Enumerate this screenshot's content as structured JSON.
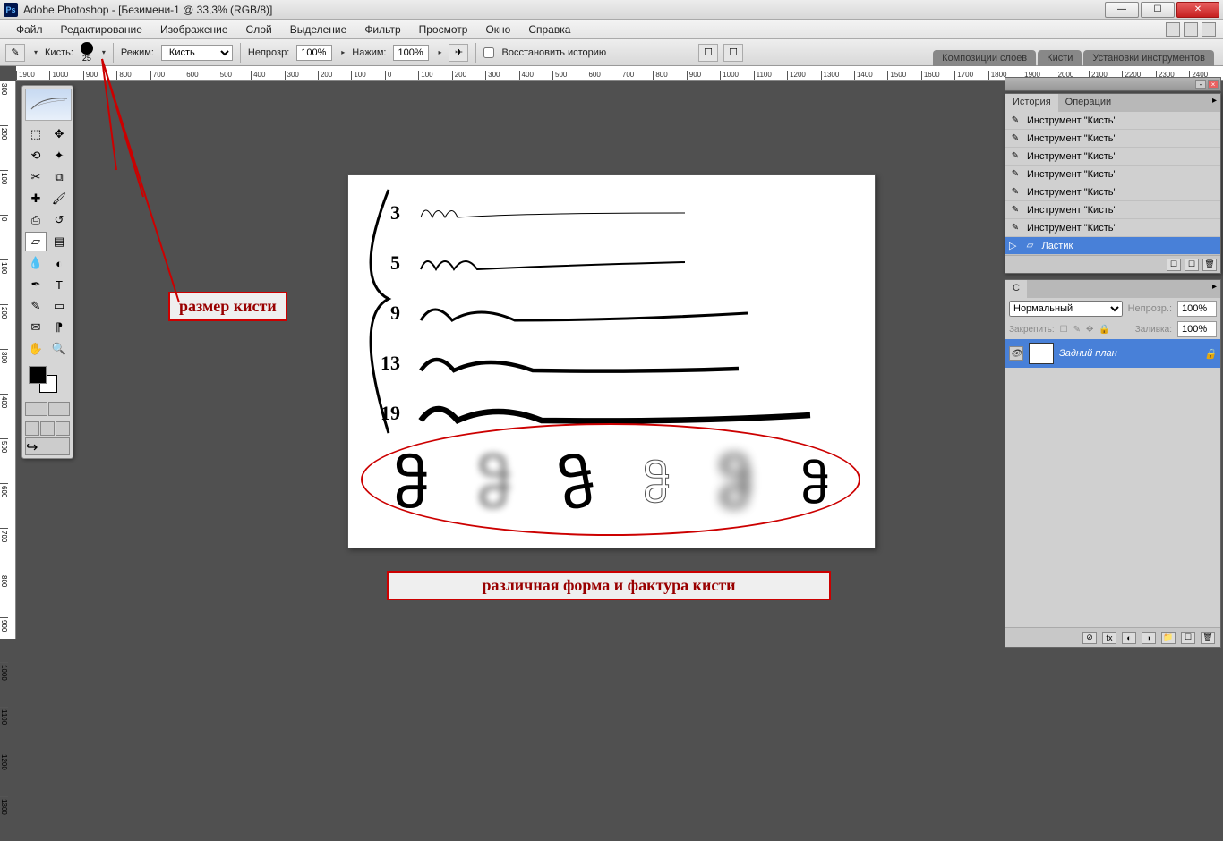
{
  "titlebar": {
    "app": "Adobe Photoshop - [Безимени-1 @ 33,3% (RGB/8)]",
    "logo_text": "Ps"
  },
  "menu": {
    "items": [
      "Файл",
      "Редактирование",
      "Изображение",
      "Слой",
      "Выделение",
      "Фильтр",
      "Просмотр",
      "Окно",
      "Справка"
    ]
  },
  "options": {
    "brush_label": "Кисть:",
    "brush_size": "25",
    "mode_label": "Режим:",
    "mode_value": "Кисть",
    "opacity_label": "Непрозр:",
    "opacity_value": "100%",
    "flow_label": "Нажим:",
    "flow_value": "100%",
    "restore_label": "Восстановить историю"
  },
  "inactive_tabs": [
    "Композиции слоев",
    "Кисти",
    "Установки инструментов"
  ],
  "ruler_values": [
    "1900",
    "1000",
    "900",
    "800",
    "700",
    "600",
    "500",
    "400",
    "300",
    "200",
    "100",
    "0",
    "100",
    "200",
    "300",
    "400",
    "500",
    "600",
    "700",
    "800",
    "900",
    "1000",
    "1100",
    "1200",
    "1300",
    "1400",
    "1500",
    "1600",
    "1700",
    "1800",
    "1900",
    "2000",
    "2100",
    "2200",
    "2300",
    "2400"
  ],
  "v_ruler_values": [
    "300",
    "200",
    "100",
    "0",
    "100",
    "200",
    "300",
    "400",
    "500",
    "600",
    "700",
    "800",
    "900",
    "1000",
    "1100",
    "1200",
    "1300"
  ],
  "canvas": {
    "stroke_sizes": [
      "3",
      "5",
      "9",
      "13",
      "19"
    ]
  },
  "annotations": {
    "size_label": "размер кисти",
    "shapes_label": "различная форма и фактура кисти"
  },
  "history_panel": {
    "tab_history": "История",
    "tab_actions": "Операции",
    "items": [
      "Инструмент \"Кисть\"",
      "Инструмент \"Кисть\"",
      "Инструмент \"Кисть\"",
      "Инструмент \"Кисть\"",
      "Инструмент \"Кисть\"",
      "Инструмент \"Кисть\"",
      "Инструмент \"Кисть\""
    ],
    "active_item": "Ластик"
  },
  "layers_panel": {
    "tab_layers": "С",
    "blend_mode": "Нормальный",
    "opacity_label": "Непрозр.:",
    "opacity_value": "100%",
    "lock_label": "Закрепить:",
    "fill_label": "Заливка:",
    "fill_value": "100%",
    "bg_layer": "Задний план"
  }
}
